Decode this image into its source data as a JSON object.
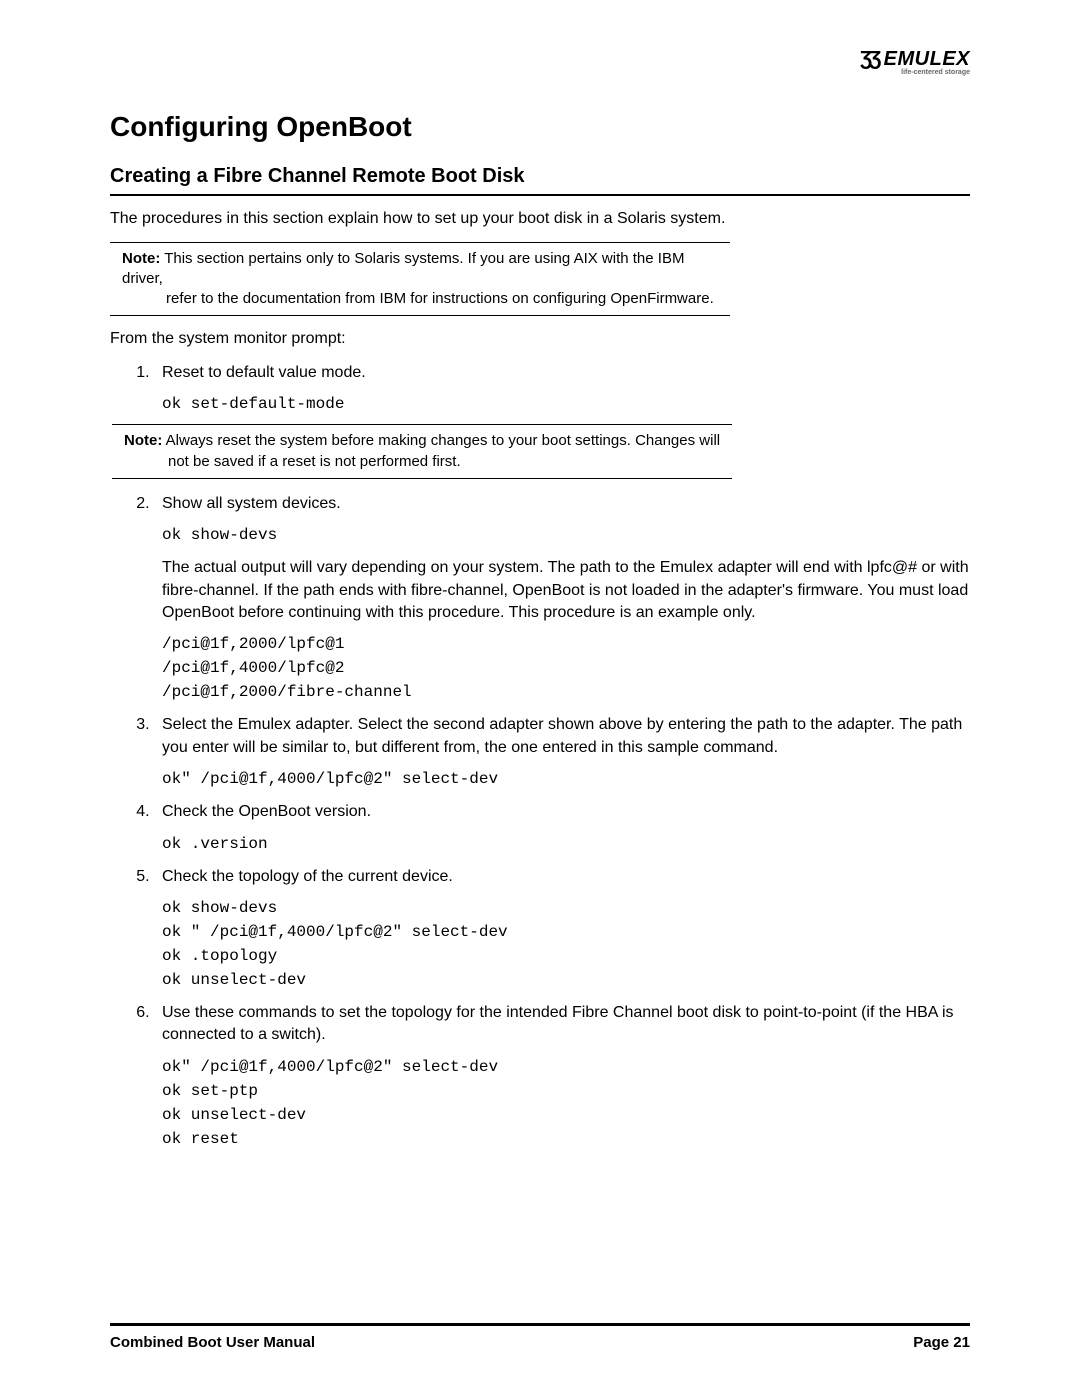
{
  "logo": {
    "brand": "EMULEX",
    "tagline": "life-centered storage"
  },
  "h1": "Configuring OpenBoot",
  "h2": "Creating a Fibre Channel Remote Boot Disk",
  "intro": "The procedures in this section explain how to set up your boot disk in a Solaris system.",
  "note1": {
    "label": "Note:",
    "line1": " This section pertains only to Solaris systems. If you are using AIX with the IBM driver,",
    "line2": "refer to the documentation from IBM for instructions on configuring OpenFirmware."
  },
  "prompt_intro": "From the system monitor prompt:",
  "step1": {
    "text": "Reset to default value mode.",
    "code": "ok set-default-mode"
  },
  "note2": {
    "label": "Note:",
    "line1": " Always reset the system before making changes to your boot settings. Changes will",
    "line2": "not be saved if a reset is not performed first."
  },
  "step2": {
    "text": "Show all system devices.",
    "code1": "ok show-devs",
    "para": "The actual output will vary depending on your system. The path to the Emulex adapter will end with lpfc@# or with fibre-channel. If the path ends with fibre-channel, OpenBoot is not loaded in the adapter's firmware. You must load OpenBoot before continuing with this procedure. This procedure is an example only.",
    "code2": "/pci@1f,2000/lpfc@1\n/pci@1f,4000/lpfc@2\n/pci@1f,2000/fibre-channel"
  },
  "step3": {
    "text": "Select the Emulex adapter. Select the second adapter shown above by entering the path to the adapter. The path you enter will be similar to, but different from, the one entered in this sample command.",
    "code": "ok\" /pci@1f,4000/lpfc@2\" select-dev"
  },
  "step4": {
    "text": "Check the OpenBoot version.",
    "code": "ok .version"
  },
  "step5": {
    "text": "Check the topology of the current device.",
    "code": "ok show-devs\nok \" /pci@1f,4000/lpfc@2\" select-dev\nok .topology\nok unselect-dev"
  },
  "step6": {
    "text": "Use these commands to set the topology for the intended Fibre Channel boot disk to point-to-point (if the HBA is connected to a switch).",
    "code": "ok\" /pci@1f,4000/lpfc@2\" select-dev\nok set-ptp\nok unselect-dev\nok reset"
  },
  "footer": {
    "left": "Combined Boot User Manual",
    "right": "Page 21"
  }
}
